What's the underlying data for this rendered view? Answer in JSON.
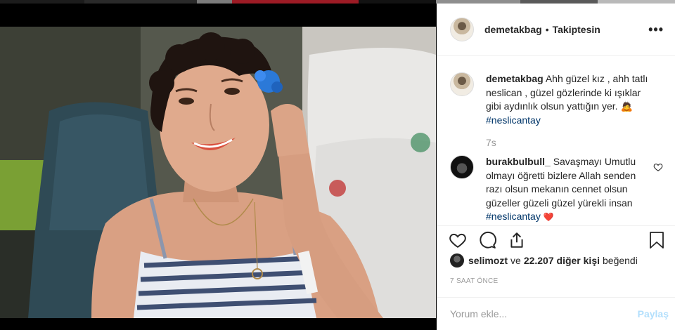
{
  "top_strip": {
    "colors": [
      "#1c1c1c",
      "#9d1b25",
      "#2a2a2a",
      "#7c7c7c",
      "#121212",
      "#8e8e8e",
      "#5a5a5a",
      "#b9b9b9"
    ]
  },
  "photo": {
    "description_icon": "photo-icon",
    "colors": {
      "hair": "#1f1410",
      "skin": "#d9a083",
      "flower": "#2b79d8",
      "chair": "#2f4a55",
      "stripes": "#3f4f72"
    }
  },
  "header": {
    "username": "demetakbag",
    "separator": "•",
    "follow_status": "Takiptesin",
    "more_icon": "more-icon",
    "more_glyph": "•••"
  },
  "comments": [
    {
      "username": "demetakbag",
      "text": "Ahh güzel kız , ahh tatlı neslican , güzel gözlerinde ki ışıklar gibi aydınlık olsun yattığın yer. 🙇",
      "hashtag": "#neslicantay"
    },
    {
      "username": "burakbulbull_",
      "text": "Savaşmayı Umutlu olmayı öğretti bizlere Allah senden razı olsun mekanın cennet olsun güzeller güzeli güzel yürekli insan",
      "hashtag": "#neslicantay",
      "emoji": "❤️"
    }
  ],
  "caption_time": "7s",
  "actions": {
    "like_icon": "heart-icon",
    "comment_icon": "comment-icon",
    "share_icon": "share-icon",
    "save_icon": "bookmark-icon"
  },
  "likes": {
    "user": "selimozt",
    "and": "ve",
    "others": "22.207 diğer kişi",
    "suffix": "beğendi"
  },
  "time_ago": "7 SAAT ÖNCE",
  "add_comment": {
    "placeholder": "Yorum ekle...",
    "post_label": "Paylaş"
  },
  "colors": {
    "hashtag": "#003569",
    "muted": "#999999",
    "post_disabled": "#b2dffc",
    "text": "#262626"
  }
}
